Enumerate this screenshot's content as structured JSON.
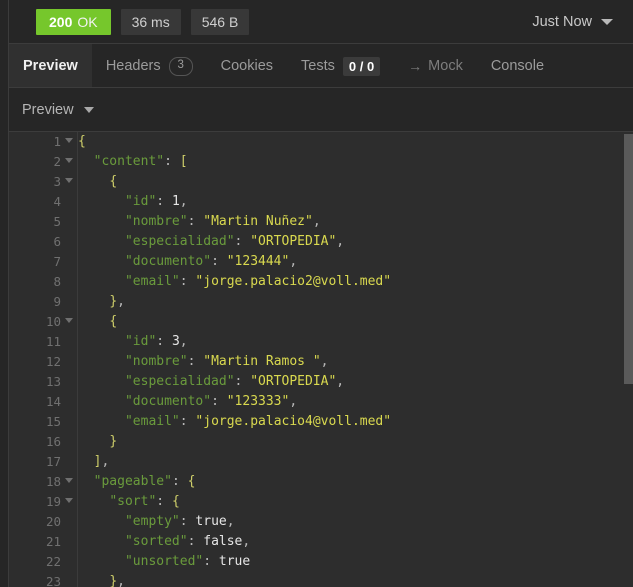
{
  "status_bar": {
    "status_code": "200",
    "status_text": "OK",
    "duration": "36 ms",
    "size": "546 B",
    "timestamp_label": "Just Now",
    "caret_icon": "chevron-down-icon",
    "ok_color": "#76c72c"
  },
  "tabs": [
    {
      "label": "Preview",
      "badge": null,
      "active": true,
      "dim": false
    },
    {
      "label": "Headers",
      "badge": "3",
      "active": false,
      "dim": false
    },
    {
      "label": "Cookies",
      "badge": null,
      "active": false,
      "dim": false
    },
    {
      "label": "Tests",
      "badge": "0 / 0",
      "active": false,
      "dim": false
    },
    {
      "label": "Mock",
      "badge": null,
      "active": false,
      "dim": true,
      "prefix_icon": "arrow-right-icon",
      "prefix": "→"
    },
    {
      "label": "Console",
      "badge": null,
      "active": false,
      "dim": false
    }
  ],
  "sub_toolbar": {
    "view_mode": "Preview",
    "caret_icon": "chevron-down-icon"
  },
  "code": {
    "language": "json",
    "first_line": 1,
    "lines": [
      {
        "num": 1,
        "fold": true,
        "tokens": [
          {
            "t": "br",
            "v": "{"
          }
        ]
      },
      {
        "num": 2,
        "fold": true,
        "tokens": [
          {
            "t": "p",
            "v": "  "
          },
          {
            "t": "k",
            "v": "\"content\""
          },
          {
            "t": "p",
            "v": ": "
          },
          {
            "t": "br",
            "v": "["
          }
        ]
      },
      {
        "num": 3,
        "fold": true,
        "tokens": [
          {
            "t": "p",
            "v": "    "
          },
          {
            "t": "br",
            "v": "{"
          }
        ]
      },
      {
        "num": 4,
        "fold": false,
        "tokens": [
          {
            "t": "p",
            "v": "      "
          },
          {
            "t": "k",
            "v": "\"id\""
          },
          {
            "t": "p",
            "v": ": "
          },
          {
            "t": "n",
            "v": "1"
          },
          {
            "t": "p",
            "v": ","
          }
        ]
      },
      {
        "num": 5,
        "fold": false,
        "tokens": [
          {
            "t": "p",
            "v": "      "
          },
          {
            "t": "k",
            "v": "\"nombre\""
          },
          {
            "t": "p",
            "v": ": "
          },
          {
            "t": "s",
            "v": "\"Martin Nuñez\""
          },
          {
            "t": "p",
            "v": ","
          }
        ]
      },
      {
        "num": 6,
        "fold": false,
        "tokens": [
          {
            "t": "p",
            "v": "      "
          },
          {
            "t": "k",
            "v": "\"especialidad\""
          },
          {
            "t": "p",
            "v": ": "
          },
          {
            "t": "s",
            "v": "\"ORTOPEDIA\""
          },
          {
            "t": "p",
            "v": ","
          }
        ]
      },
      {
        "num": 7,
        "fold": false,
        "tokens": [
          {
            "t": "p",
            "v": "      "
          },
          {
            "t": "k",
            "v": "\"documento\""
          },
          {
            "t": "p",
            "v": ": "
          },
          {
            "t": "s",
            "v": "\"123444\""
          },
          {
            "t": "p",
            "v": ","
          }
        ]
      },
      {
        "num": 8,
        "fold": false,
        "tokens": [
          {
            "t": "p",
            "v": "      "
          },
          {
            "t": "k",
            "v": "\"email\""
          },
          {
            "t": "p",
            "v": ": "
          },
          {
            "t": "s",
            "v": "\"jorge.palacio2@voll.med\""
          }
        ]
      },
      {
        "num": 9,
        "fold": false,
        "tokens": [
          {
            "t": "p",
            "v": "    "
          },
          {
            "t": "br",
            "v": "}"
          },
          {
            "t": "p",
            "v": ","
          }
        ]
      },
      {
        "num": 10,
        "fold": true,
        "tokens": [
          {
            "t": "p",
            "v": "    "
          },
          {
            "t": "br",
            "v": "{"
          }
        ]
      },
      {
        "num": 11,
        "fold": false,
        "tokens": [
          {
            "t": "p",
            "v": "      "
          },
          {
            "t": "k",
            "v": "\"id\""
          },
          {
            "t": "p",
            "v": ": "
          },
          {
            "t": "n",
            "v": "3"
          },
          {
            "t": "p",
            "v": ","
          }
        ]
      },
      {
        "num": 12,
        "fold": false,
        "tokens": [
          {
            "t": "p",
            "v": "      "
          },
          {
            "t": "k",
            "v": "\"nombre\""
          },
          {
            "t": "p",
            "v": ": "
          },
          {
            "t": "s",
            "v": "\"Martin Ramos \""
          },
          {
            "t": "p",
            "v": ","
          }
        ]
      },
      {
        "num": 13,
        "fold": false,
        "tokens": [
          {
            "t": "p",
            "v": "      "
          },
          {
            "t": "k",
            "v": "\"especialidad\""
          },
          {
            "t": "p",
            "v": ": "
          },
          {
            "t": "s",
            "v": "\"ORTOPEDIA\""
          },
          {
            "t": "p",
            "v": ","
          }
        ]
      },
      {
        "num": 14,
        "fold": false,
        "tokens": [
          {
            "t": "p",
            "v": "      "
          },
          {
            "t": "k",
            "v": "\"documento\""
          },
          {
            "t": "p",
            "v": ": "
          },
          {
            "t": "s",
            "v": "\"123333\""
          },
          {
            "t": "p",
            "v": ","
          }
        ]
      },
      {
        "num": 15,
        "fold": false,
        "tokens": [
          {
            "t": "p",
            "v": "      "
          },
          {
            "t": "k",
            "v": "\"email\""
          },
          {
            "t": "p",
            "v": ": "
          },
          {
            "t": "s",
            "v": "\"jorge.palacio4@voll.med\""
          }
        ]
      },
      {
        "num": 16,
        "fold": false,
        "tokens": [
          {
            "t": "p",
            "v": "    "
          },
          {
            "t": "br",
            "v": "}"
          }
        ]
      },
      {
        "num": 17,
        "fold": false,
        "tokens": [
          {
            "t": "p",
            "v": "  "
          },
          {
            "t": "br",
            "v": "]"
          },
          {
            "t": "p",
            "v": ","
          }
        ]
      },
      {
        "num": 18,
        "fold": true,
        "tokens": [
          {
            "t": "p",
            "v": "  "
          },
          {
            "t": "k",
            "v": "\"pageable\""
          },
          {
            "t": "p",
            "v": ": "
          },
          {
            "t": "br",
            "v": "{"
          }
        ]
      },
      {
        "num": 19,
        "fold": true,
        "tokens": [
          {
            "t": "p",
            "v": "    "
          },
          {
            "t": "k",
            "v": "\"sort\""
          },
          {
            "t": "p",
            "v": ": "
          },
          {
            "t": "br",
            "v": "{"
          }
        ]
      },
      {
        "num": 20,
        "fold": false,
        "tokens": [
          {
            "t": "p",
            "v": "      "
          },
          {
            "t": "k",
            "v": "\"empty\""
          },
          {
            "t": "p",
            "v": ": "
          },
          {
            "t": "b",
            "v": "true"
          },
          {
            "t": "p",
            "v": ","
          }
        ]
      },
      {
        "num": 21,
        "fold": false,
        "tokens": [
          {
            "t": "p",
            "v": "      "
          },
          {
            "t": "k",
            "v": "\"sorted\""
          },
          {
            "t": "p",
            "v": ": "
          },
          {
            "t": "b",
            "v": "false"
          },
          {
            "t": "p",
            "v": ","
          }
        ]
      },
      {
        "num": 22,
        "fold": false,
        "tokens": [
          {
            "t": "p",
            "v": "      "
          },
          {
            "t": "k",
            "v": "\"unsorted\""
          },
          {
            "t": "p",
            "v": ": "
          },
          {
            "t": "b",
            "v": "true"
          }
        ]
      },
      {
        "num": 23,
        "fold": false,
        "tokens": [
          {
            "t": "p",
            "v": "    "
          },
          {
            "t": "br",
            "v": "}"
          },
          {
            "t": "p",
            "v": ","
          }
        ]
      }
    ]
  },
  "scrollbar": {
    "orientation": "vertical",
    "visible": true
  }
}
